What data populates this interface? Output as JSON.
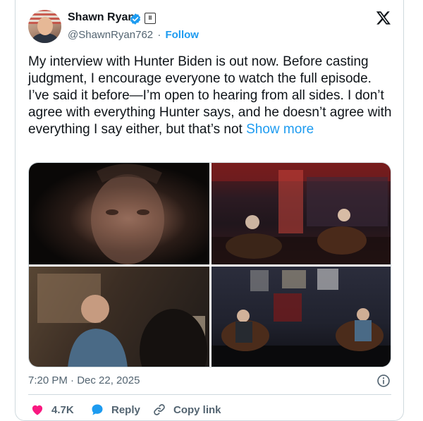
{
  "tweet": {
    "author_name": "Shawn Ryan",
    "handle": "@ShawnRyan762",
    "separator": "·",
    "follow_label": "Follow",
    "badge_text": "II",
    "body": "My interview with Hunter Biden is out now. Before casting judgment, I encourage everyone to watch the full episode. I’ve said it before—I’m open to hearing from all sides. I don’t agree with everything Hunter says, and he doesn’t agree with everything I say either, but that’s not",
    "show_more_label": "Show more",
    "timestamp": "7:20 PM · Dec 22, 2025"
  },
  "media": {
    "count": 4
  },
  "actions": {
    "likes_count": "4.7K",
    "reply_label": "Reply",
    "copy_link_label": "Copy link"
  },
  "colors": {
    "accent": "#1d9bf0",
    "like": "#f91880",
    "secondary_text": "#536471",
    "border": "#cfd9de"
  },
  "icons": [
    "verified-icon",
    "x-logo-icon",
    "info-icon",
    "heart-icon",
    "reply-icon",
    "link-icon"
  ]
}
